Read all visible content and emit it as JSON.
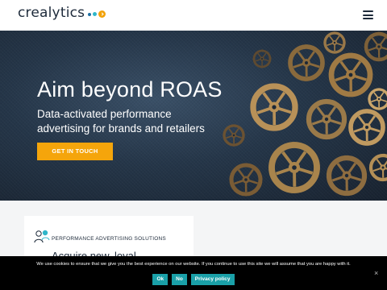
{
  "header": {
    "logo_text": "crealytics",
    "logo_icon": "logo-dots-icon",
    "menu_icon": "hamburger-icon"
  },
  "hero": {
    "title": "Aim beyond ROAS",
    "subtitle": "Data-activated performance advertising for brands and retailers",
    "cta_label": "GET IN TOUCH",
    "background_image": "gears-image"
  },
  "card": {
    "icon": "users-icon",
    "label": "PERFORMANCE ADVERTISING SOLUTIONS",
    "heading": "Acquire new, loyal"
  },
  "cookie": {
    "text": "We use cookies to ensure that we give you the best experience on our website. If you continue to use this site we will assume that you are happy with it.",
    "buttons": [
      "Ok",
      "No",
      "Privacy policy"
    ],
    "close_label": "×"
  },
  "colors": {
    "accent": "#f5a50b",
    "teal": "#1aa0a8",
    "navy": "#1d2a3a",
    "hero_bg": "#253649"
  }
}
